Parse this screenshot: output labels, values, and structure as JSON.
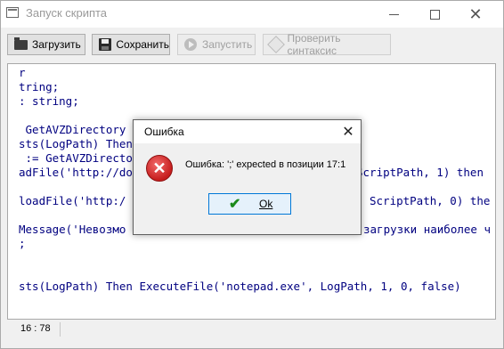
{
  "window": {
    "title": "Запуск скрипта"
  },
  "toolbar": {
    "load_label": "Загрузить",
    "save_label": "Сохранить",
    "run_label": "Запустить",
    "check_label": "Проверить синтаксис"
  },
  "editor": {
    "lines": [
      "r",
      "tring;",
      ": string;",
      "",
      " GetAVZDirectory",
      "sts(LogPath) Then",
      " := GetAVZDirecto",
      "adFile('http://do",
      "",
      "loadFile('http:/",
      "",
      "Message('Невозмо",
      ";",
      "",
      "",
      "sts(LogPath) Then ExecuteFile('notepad.exe', LogPath, 1, 0, false)"
    ],
    "right_fragments": [
      "ScriptPath, 1) then",
      "ScriptPath, 0) the",
      "загрузки наиболее ч"
    ]
  },
  "status": {
    "position": "16 : 78"
  },
  "dialog": {
    "title": "Ошибка",
    "message": "Ошибка: ';' expected в позиции 17:1",
    "ok_label": "Ok"
  },
  "colors": {
    "code": "#000080",
    "ok_border": "#0078d7"
  }
}
